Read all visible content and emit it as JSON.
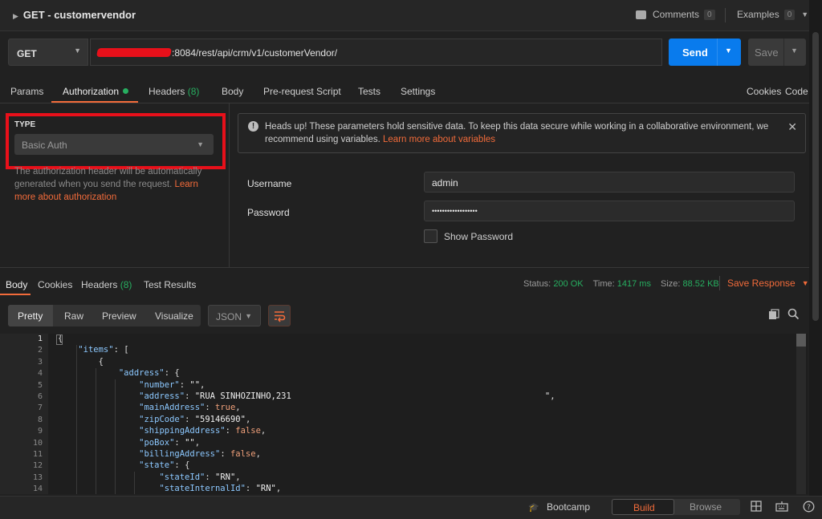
{
  "request": {
    "title": "GET - customervendor",
    "comments_label": "Comments",
    "comments_count": "0",
    "examples_label": "Examples",
    "examples_count": "0",
    "method": "GET",
    "url_visible": ":8084/rest/api/crm/v1/customerVendor/",
    "send_label": "Send",
    "save_label": "Save"
  },
  "tabs": [
    {
      "label": "Params"
    },
    {
      "label": "Authorization"
    },
    {
      "label": "Headers",
      "count": "(8)"
    },
    {
      "label": "Body"
    },
    {
      "label": "Pre-request Script"
    },
    {
      "label": "Tests"
    },
    {
      "label": "Settings"
    }
  ],
  "right_links": {
    "cookies": "Cookies",
    "code": "Code"
  },
  "auth": {
    "type_label": "TYPE",
    "type_value": "Basic Auth",
    "desc_text": "The authorization header will be automatically generated when you send the request. ",
    "desc_link": "Learn more about authorization",
    "headsup_text": "Heads up! These parameters hold sensitive data. To keep this data secure while working in a collaborative environment, we recommend using variables. ",
    "headsup_link": "Learn more about variables",
    "username_label": "Username",
    "username_value": "admin",
    "password_label": "Password",
    "password_value": "••••••••••••••••••",
    "show_password_label": "Show Password"
  },
  "response": {
    "tabs": [
      {
        "label": "Body"
      },
      {
        "label": "Cookies"
      },
      {
        "label": "Headers",
        "count": "(8)"
      },
      {
        "label": "Test Results"
      }
    ],
    "status_label": "Status:",
    "status_value": "200 OK",
    "time_label": "Time:",
    "time_value": "1417 ms",
    "size_label": "Size:",
    "size_value": "88.52 KB",
    "save_response_label": "Save Response",
    "view_modes": [
      "Pretty",
      "Raw",
      "Preview",
      "Visualize"
    ],
    "format": "JSON",
    "code_lines": [
      {
        "n": "1",
        "text": "{"
      },
      {
        "n": "2",
        "text": "    \"items\": ["
      },
      {
        "n": "3",
        "text": "        {"
      },
      {
        "n": "4",
        "text": "            \"address\": {"
      },
      {
        "n": "5",
        "text": "                \"number\": \"\","
      },
      {
        "n": "6",
        "text": "                \"address\": \"RUA SINHOZINHO,231                                                  \","
      },
      {
        "n": "7",
        "text": "                \"mainAddress\": true,"
      },
      {
        "n": "8",
        "text": "                \"zipCode\": \"59146690\","
      },
      {
        "n": "9",
        "text": "                \"shippingAddress\": false,"
      },
      {
        "n": "10",
        "text": "                \"poBox\": \"\","
      },
      {
        "n": "11",
        "text": "                \"billingAddress\": false,"
      },
      {
        "n": "12",
        "text": "                \"state\": {"
      },
      {
        "n": "13",
        "text": "                    \"stateId\": \"RN\","
      },
      {
        "n": "14",
        "text": "                    \"stateInternalId\": \"RN\","
      }
    ]
  },
  "footer": {
    "bootcamp": "Bootcamp",
    "build": "Build",
    "browse": "Browse"
  },
  "colors": {
    "accent": "#f26b3a",
    "send": "#097bed",
    "success": "#27ae60",
    "highlight": "#e8101a"
  }
}
